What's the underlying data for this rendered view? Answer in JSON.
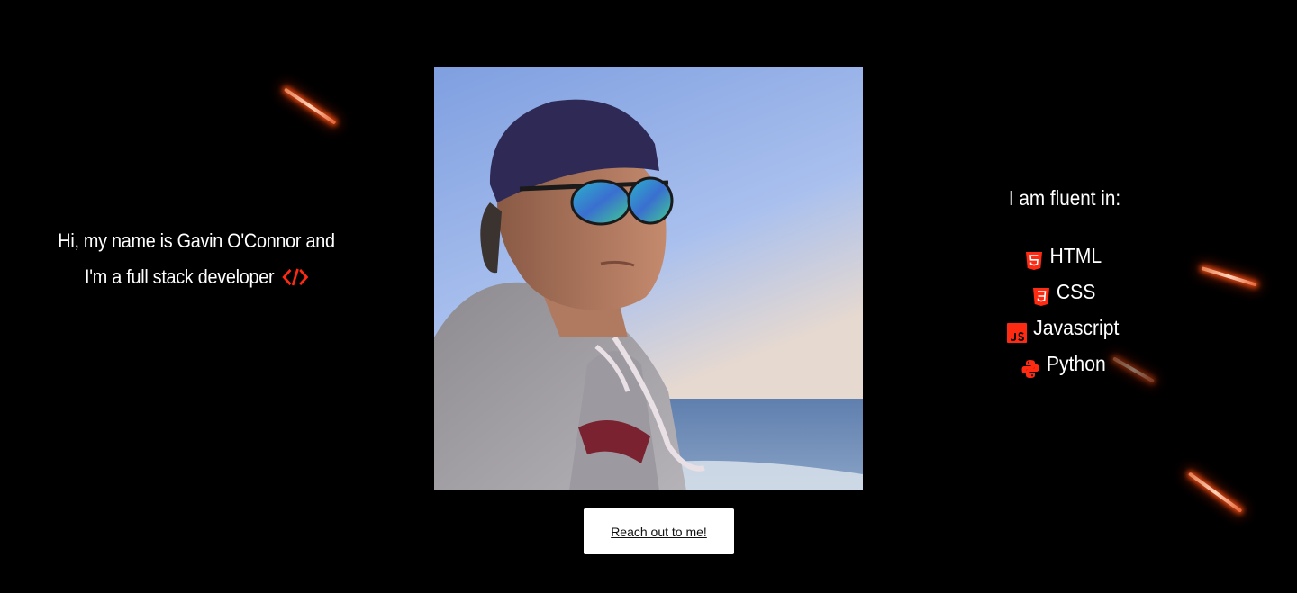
{
  "intro": {
    "line1": "Hi, my name is Gavin O'Connor and",
    "line2": "I'm a full stack developer",
    "icon": "code-icon"
  },
  "photo": {
    "description_icon": "portrait-photo"
  },
  "cta": {
    "label": "Reach out to me!"
  },
  "skills": {
    "heading": "I am fluent in:",
    "items": [
      {
        "label": "HTML",
        "icon": "html5-icon"
      },
      {
        "label": "CSS",
        "icon": "css3-icon"
      },
      {
        "label": "Javascript",
        "icon": "js-icon"
      },
      {
        "label": "Python",
        "icon": "python-icon"
      }
    ]
  },
  "colors": {
    "background": "#000000",
    "text": "#ffffff",
    "accent": "#ff2a12",
    "button_bg": "#ffffff",
    "button_text": "#111111",
    "streak_glow": "#ff5a1a"
  }
}
